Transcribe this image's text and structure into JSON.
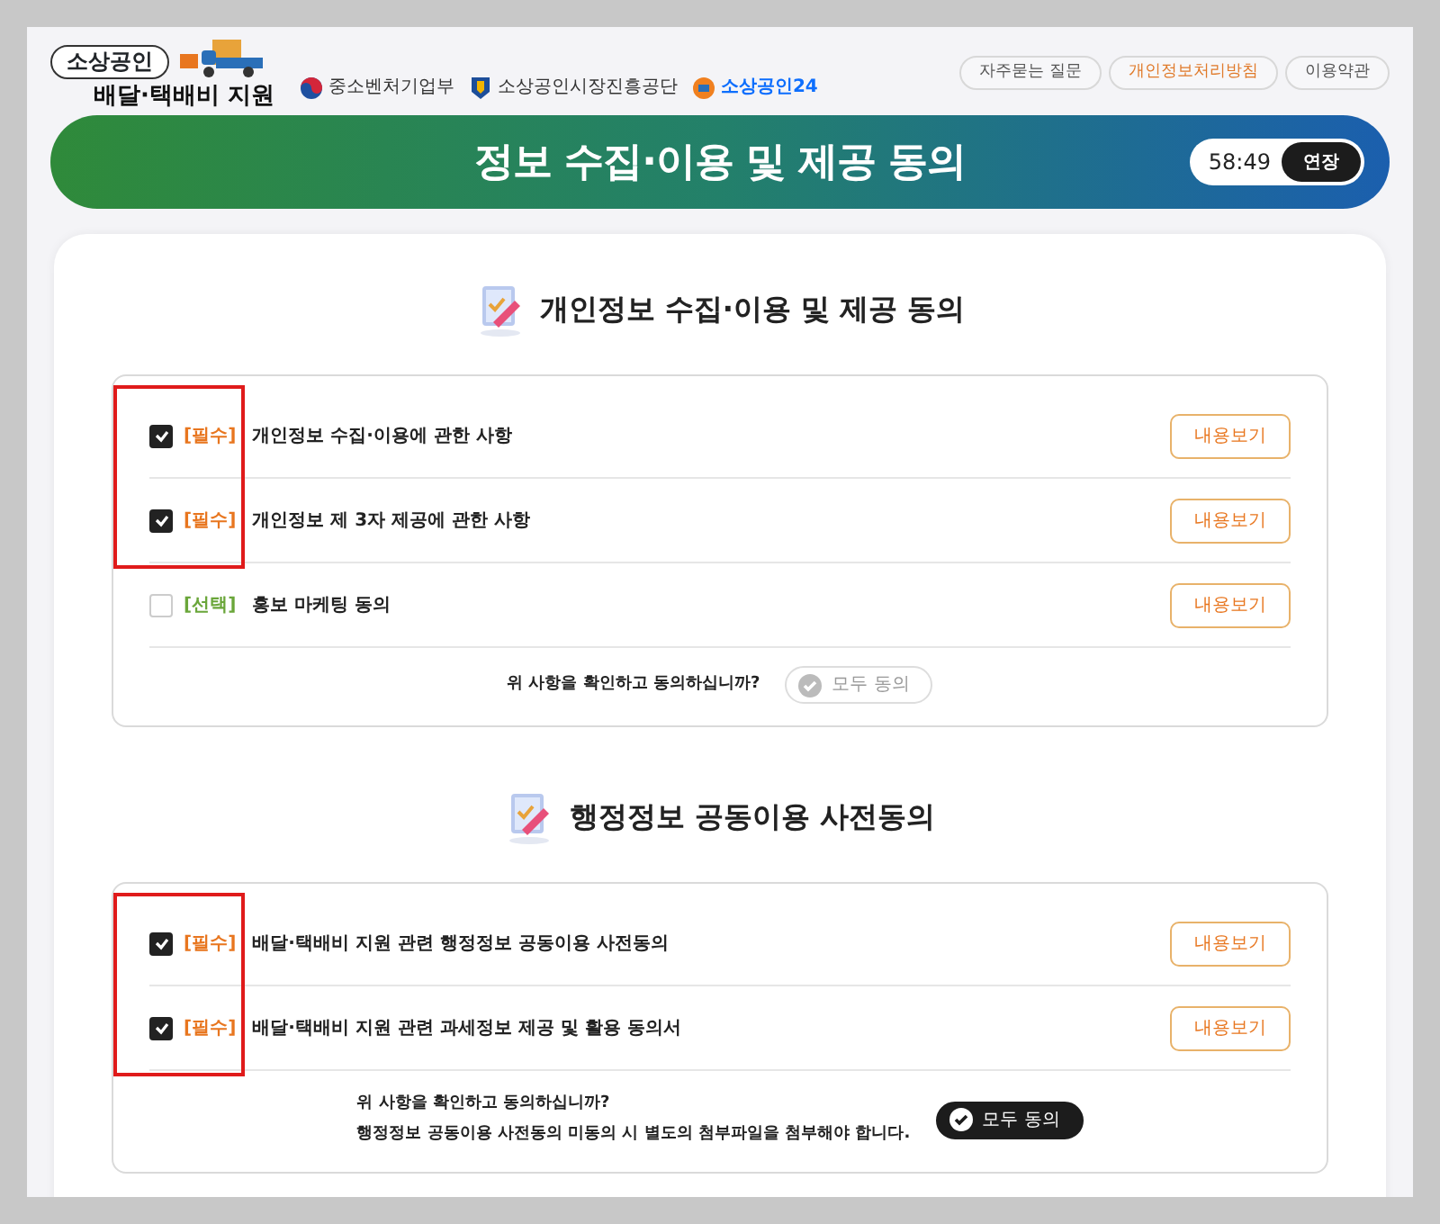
{
  "header": {
    "logo_tag": "소상공인",
    "logo_title": "배달·택배비 지원",
    "agencies": [
      {
        "kind": "ministry",
        "label": "중소벤처기업부"
      },
      {
        "kind": "agency",
        "label": "소상공인시장진흥공단"
      },
      {
        "kind": "portal",
        "label": "소상공인24"
      }
    ],
    "links": [
      {
        "label": "자주묻는 질문",
        "selected": false
      },
      {
        "label": "개인정보처리방침",
        "selected": true
      },
      {
        "label": "이용약관",
        "selected": false
      }
    ]
  },
  "banner": {
    "title": "정보 수집·이용 및 제공 동의",
    "timer": "58:49",
    "extend_button": "연장"
  },
  "sections": [
    {
      "title": "개인정보 수집·이용 및 제공 동의",
      "items": [
        {
          "tag": "[필수]",
          "kind": "required",
          "label": "개인정보 수집·이용에 관한 사항",
          "checked": true,
          "highlighted": true,
          "button": "내용보기"
        },
        {
          "tag": "[필수]",
          "kind": "required",
          "label": "개인정보 제 3자 제공에 관한 사항",
          "checked": true,
          "highlighted": true,
          "button": "내용보기"
        },
        {
          "tag": "[선택]",
          "kind": "optional",
          "label": "홍보 마케팅 동의",
          "checked": false,
          "highlighted": false,
          "button": "내용보기"
        }
      ],
      "question": [
        "위 사항을 확인하고 동의하십니까?"
      ],
      "agree_all": {
        "label": "모두 동의",
        "disabled": true
      }
    },
    {
      "title": "행정정보 공동이용 사전동의",
      "items": [
        {
          "tag": "[필수]",
          "kind": "required",
          "label": "배달·택배비 지원 관련 행정정보 공동이용 사전동의",
          "checked": true,
          "highlighted": true,
          "button": "내용보기"
        },
        {
          "tag": "[필수]",
          "kind": "required",
          "label": "배달·택배비 지원 관련 과세정보 제공 및 활용 동의서",
          "checked": true,
          "highlighted": true,
          "button": "내용보기"
        }
      ],
      "question": [
        "위 사항을 확인하고 동의하십니까?",
        "행정정보 공동이용 사전동의 미동의 시 별도의 첨부파일을 첨부해야 합니다."
      ],
      "agree_all": {
        "label": "모두 동의",
        "disabled": false
      }
    }
  ]
}
